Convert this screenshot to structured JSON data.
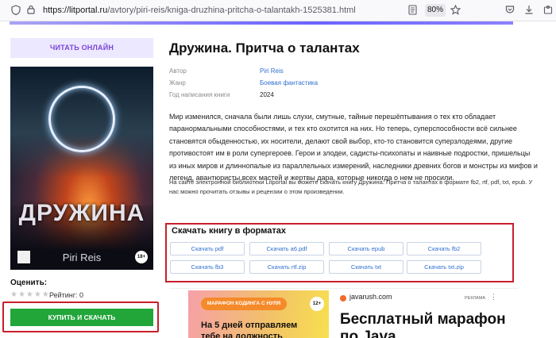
{
  "browser": {
    "url_host": "https://litportal.ru",
    "url_path": "/avtory/piri-reis/kniga-druzhina-pritcha-o-talantakh-1525381.html",
    "zoom": "80%"
  },
  "left": {
    "read_online": "ЧИТАТЬ ОНЛАЙН",
    "cover_title": "ДРУЖИНА",
    "cover_author": "Piri Reis",
    "cover_age": "18+",
    "rate_label": "Оценить:",
    "stars": "★★★★★",
    "rating": "Рейтинг: 0",
    "buy_button": "КУПИТЬ И СКАЧАТЬ"
  },
  "book": {
    "title": "Дружина. Притча о талантах",
    "meta": [
      {
        "label": "Автор",
        "value": "Piri Reis"
      },
      {
        "label": "Жанр",
        "value": "Боевая фантастика"
      },
      {
        "label": "Год написания книги",
        "value": "2024"
      }
    ],
    "description": "Мир изменился, сначала были лишь слухи, смутные, тайные перешёптывания о тех кто обладает паранормальными способностями, и тех кто охотится на них. Но теперь, суперспособности всё сильнее становятся обыденностью, их носители, делают свой выбор, кто-то становится суперзлодеями, другие противостоят им в роли супергероев. Герои и злодеи, садисты-психопаты и наивные подростки, пришельцы из иных миров и длиннопалые из параллельных измерений, наследники древних богов и монстры из мифов и легенд, авантюристы всех мастей и жертвы дара, которые никогда о нем не просили.",
    "info": "На сайте электронной библиотеки Litportal вы можете скачать книгу Дружина. Притча о талантах в формате fb2, rtf, pdf, txt, epub. У нас можно прочитать отзывы и рецензии о этом произведении."
  },
  "download": {
    "title": "Скачать книгу в форматах",
    "buttons": [
      "Скачать pdf",
      "Скачать a6.pdf",
      "Скачать epub",
      "Скачать fb2",
      "Скачать fb3",
      "Скачать rtf.zip",
      "Скачать txt",
      "Скачать txt.zip"
    ]
  },
  "ad": {
    "pill": "МАРАФОН КОДИНГА С НУЛЯ",
    "age": "12+",
    "image_text_1": "На 5 дней отправляем",
    "image_text_2": "тебе на должность",
    "domain": "javarush.com",
    "label": "РЕКЛАМА",
    "menu": "⋮",
    "headline_1": "Бесплатный марафон",
    "headline_2": "по Java"
  }
}
